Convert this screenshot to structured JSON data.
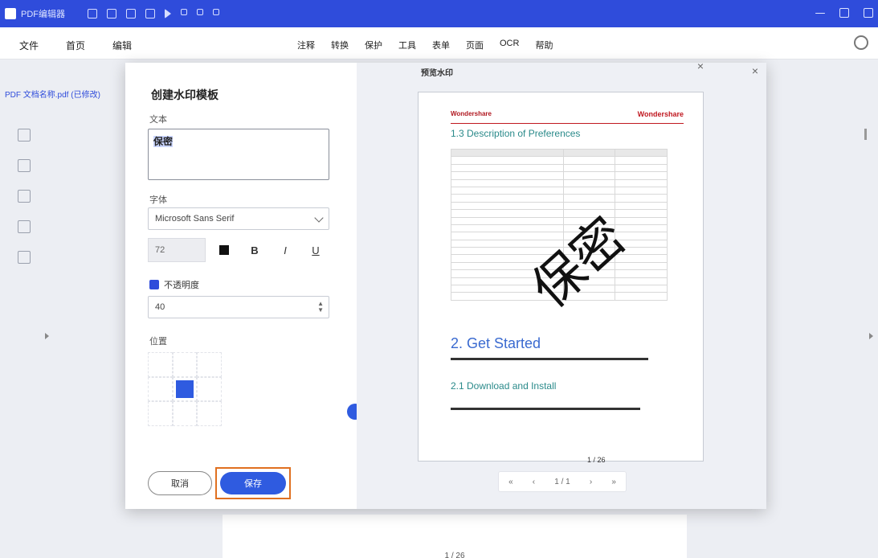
{
  "app": {
    "title": "PDF编辑器"
  },
  "menubar": {
    "left": [
      "文件",
      "首页",
      "编辑"
    ],
    "center": [
      "注释",
      "转换",
      "保护",
      "工具",
      "表单",
      "页面",
      "OCR",
      "帮助"
    ]
  },
  "doc_tab": "PDF 文档名称.pdf (已修改)",
  "dialog": {
    "title": "创建水印模板",
    "text_label": "文本",
    "text_value": "保密",
    "font_label": "字体",
    "font_value": "Microsoft Sans Serif",
    "font_size": "72",
    "bold": "B",
    "italic": "I",
    "underline": "U",
    "opacity_label": "不透明度",
    "opacity_value": "40",
    "position_label": "位置",
    "cancel": "取消",
    "ok": "保存"
  },
  "preview": {
    "title": "预览水印",
    "watermark": "保密",
    "logo_left": "Wondershare",
    "logo_right": "Wondershare",
    "section1": "1.3 Description of Preferences",
    "section2": "2. Get Started",
    "section3": "2.1 Download and Install",
    "page_mark": "1 / 26",
    "pager": [
      "«",
      "‹",
      "1 / 1",
      "›",
      "»"
    ]
  },
  "background_page_number": "1 / 26"
}
